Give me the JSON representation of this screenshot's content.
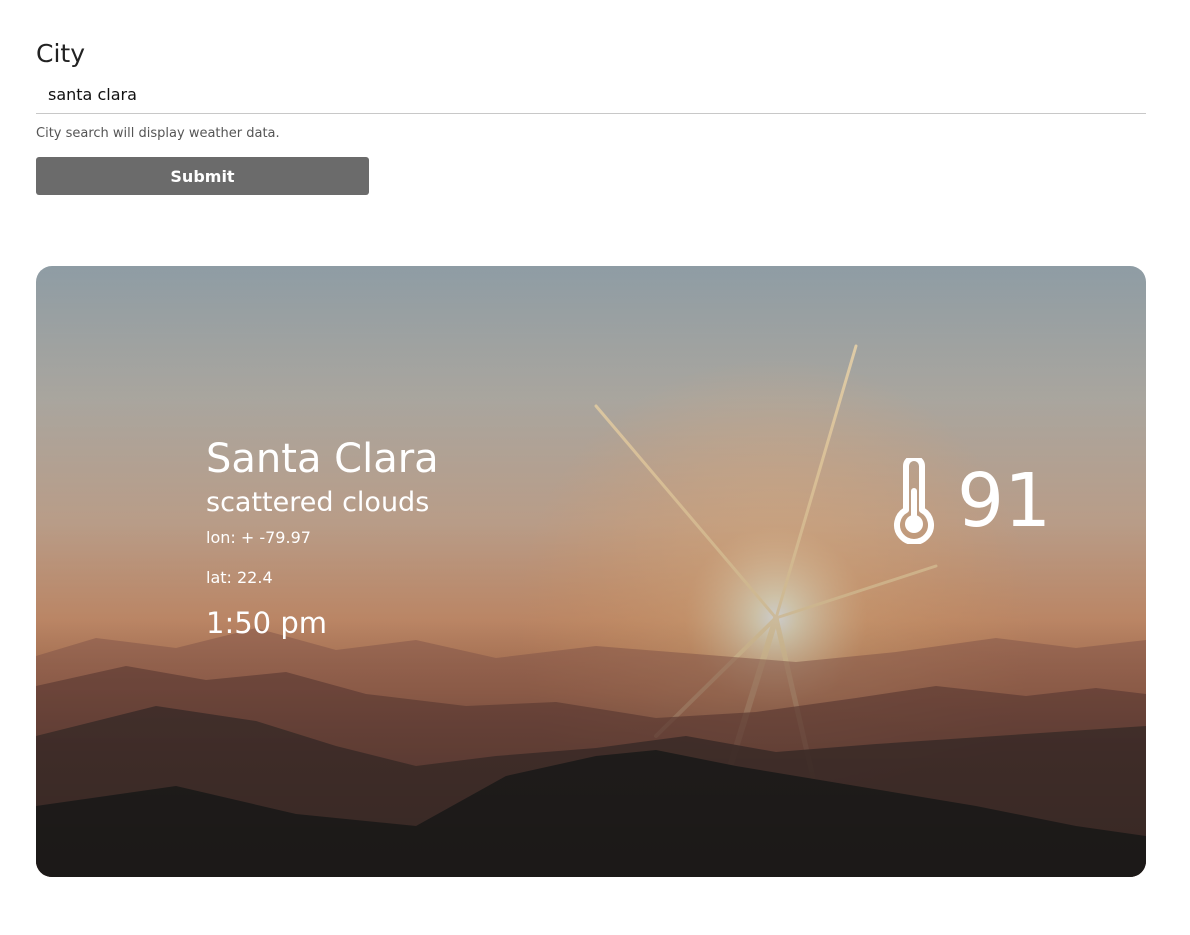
{
  "form": {
    "label": "City",
    "input_value": "santa clara",
    "helper_text": "City search will display weather data.",
    "submit_label": "Submit"
  },
  "weather": {
    "city": "Santa Clara",
    "description": "scattered clouds",
    "lon": "lon: + -79.97",
    "lat": "lat: 22.4",
    "time": "1:50 pm",
    "temperature": "91",
    "icon": "thermometer-icon"
  }
}
